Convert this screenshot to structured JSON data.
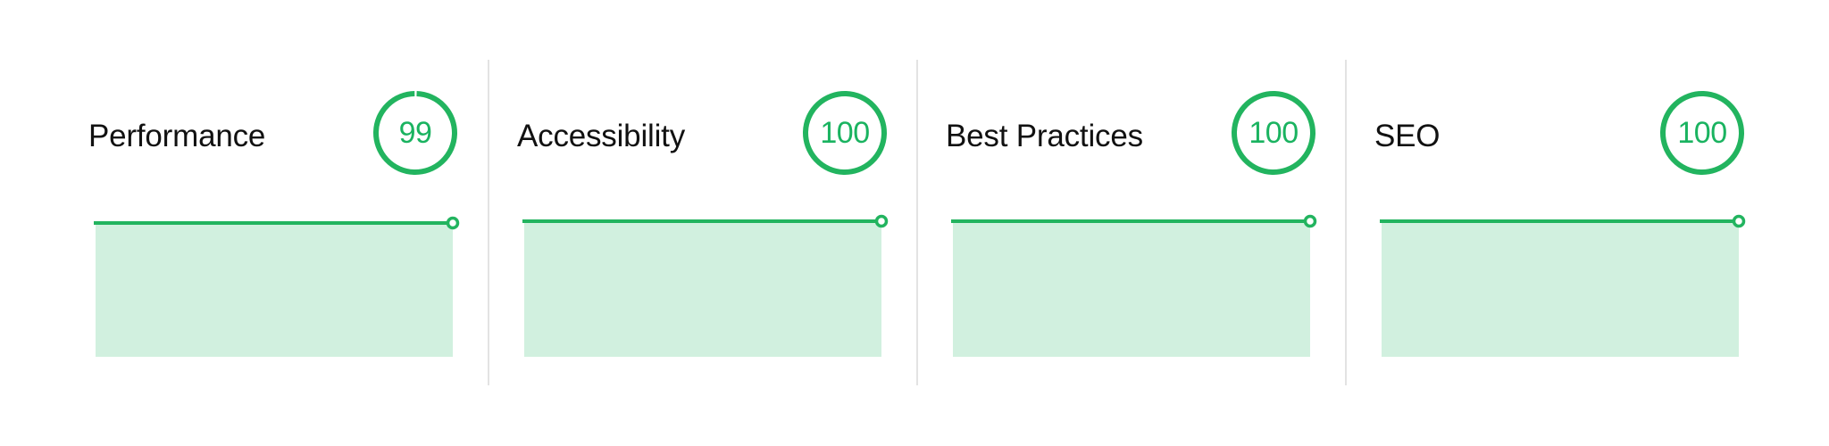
{
  "colors": {
    "accent": "#22b45f",
    "accent_text": "#1ab360",
    "fill": "#d1f0df",
    "divider": "#e3e3e3"
  },
  "cards": [
    {
      "label": "Performance",
      "score": "99",
      "score_value": 99
    },
    {
      "label": "Accessibility",
      "score": "100",
      "score_value": 100
    },
    {
      "label": "Best Practices",
      "score": "100",
      "score_value": 100
    },
    {
      "label": "SEO",
      "score": "100",
      "score_value": 100
    }
  ]
}
